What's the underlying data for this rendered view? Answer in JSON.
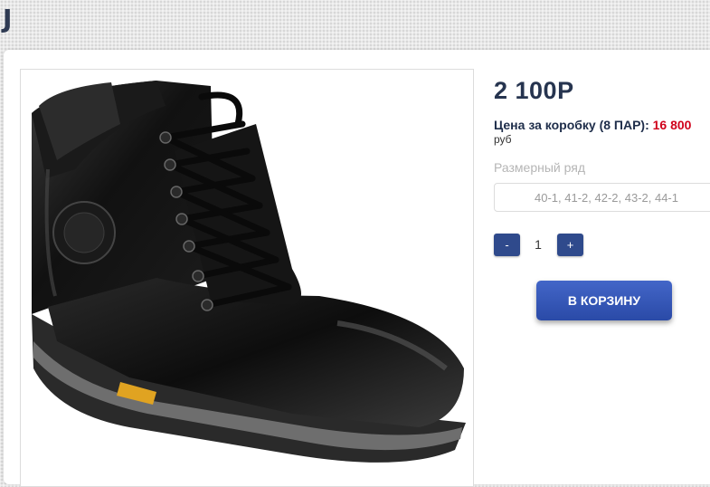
{
  "header": {
    "logo_letter": "J"
  },
  "product": {
    "image_alt": "black leather lace-up boot",
    "price": "2 100Р",
    "box_price_label": "Цена за коробку (8 ПАР): ",
    "box_price_value": "16 800",
    "currency": "руб",
    "size_label": "Размерный ряд",
    "sizes": "40-1, 41-2, 42-2, 43-2, 44-1",
    "quantity": {
      "minus_label": "-",
      "value": "1",
      "plus_label": "+"
    },
    "cart_button": "В КОРЗИНУ"
  },
  "colors": {
    "accent_blue": "#2f4a8c",
    "price_red": "#d0021b",
    "title_navy": "#26344f"
  }
}
